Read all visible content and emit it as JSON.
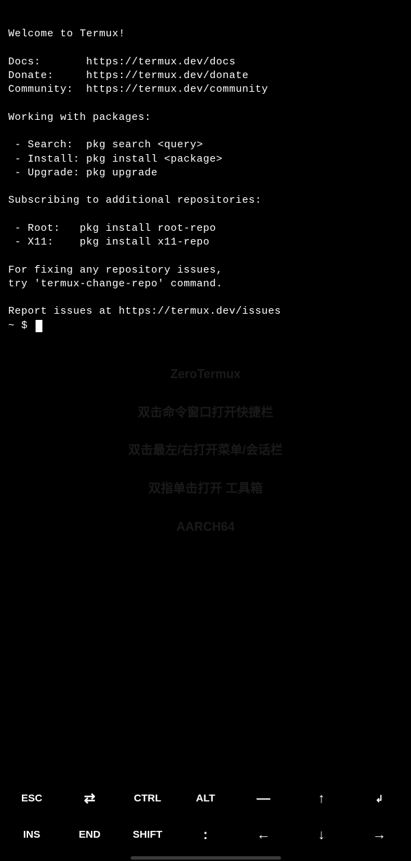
{
  "terminal": {
    "welcome": "Welcome to Termux!",
    "docs_label": "Docs:       ",
    "docs_url": "https://termux.dev/docs",
    "donate_label": "Donate:     ",
    "donate_url": "https://termux.dev/donate",
    "community_label": "Community:  ",
    "community_url": "https://termux.dev/community",
    "pkg_heading": "Working with packages:",
    "pkg_search": " - Search:  pkg search <query>",
    "pkg_install": " - Install: pkg install <package>",
    "pkg_upgrade": " - Upgrade: pkg upgrade",
    "repo_heading": "Subscribing to additional repositories:",
    "repo_root": " - Root:   pkg install root-repo",
    "repo_x11": " - X11:    pkg install x11-repo",
    "fix1": "For fixing any repository issues,",
    "fix2": "try 'termux-change-repo' command.",
    "issues": "Report issues at https://termux.dev/issues",
    "prompt": "~ $ "
  },
  "watermark": {
    "title": "ZeroTermux",
    "line1": "双击命令窗口打开快捷栏",
    "line2": "双击最左/右打开菜单/会话栏",
    "line3": "双指单击打开 工具箱",
    "arch": "AARCH64"
  },
  "keys": {
    "row1": {
      "esc": "ESC",
      "tab": "⇄",
      "ctrl": "CTRL",
      "alt": "ALT",
      "dash": "—",
      "up": "↑",
      "enter": "↲"
    },
    "row2": {
      "ins": "INS",
      "end": "END",
      "shift": "SHIFT",
      "colon": ":",
      "left": "←",
      "down": "↓",
      "right": "→"
    }
  }
}
